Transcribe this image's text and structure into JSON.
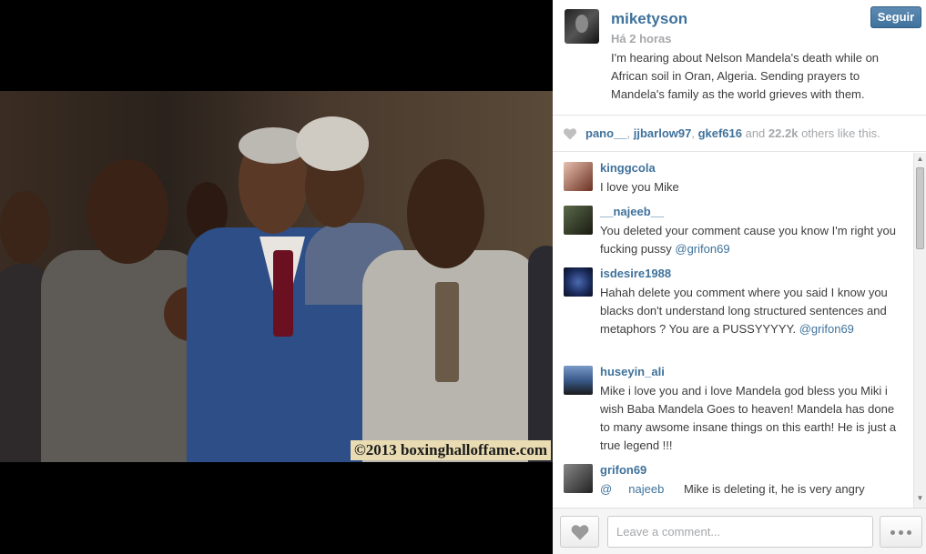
{
  "photo": {
    "watermark": "©2013 boxinghalloffame.com",
    "description_icon": "photo"
  },
  "post": {
    "username": "miketyson",
    "timestamp": "Há 2 horas",
    "caption": "I'm hearing about Nelson Mandela's death while on African soil in Oran, Algeria. Sending prayers to Mandela's family as the world grieves with them.",
    "follow_label": "Seguir"
  },
  "likes": {
    "users": [
      "pano__",
      "jjbarlow97",
      "gkef616"
    ],
    "sep": ", ",
    "and_label": " and ",
    "count": "22.2k",
    "suffix": " others like this."
  },
  "comments": [
    {
      "user": "kinggcola",
      "text": "I love you Mike",
      "mention": ""
    },
    {
      "user": "__najeeb__",
      "text": "You deleted your comment cause you know I'm right you fucking pussy ",
      "mention": "@grifon69"
    },
    {
      "user": "isdesire1988",
      "text": "Hahah delete you comment where you said I know you blacks don't understand long structured sentences and metaphors ? You are a PUSSYYYYY. ",
      "mention": "@grifon69"
    },
    {
      "user": "huseyin_ali",
      "text": "Mike i love you and i love Mandela god bless you Miki i wish Baba Mandela Goes to heaven! Mandela has done to many awsome insane things on this earth! He is just a true legend !!!",
      "mention": ""
    },
    {
      "user": "grifon69",
      "text": "Mike is deleting it, he is very angry",
      "mention": "@     najeeb"
    }
  ],
  "footer": {
    "comment_placeholder": "Leave a comment...",
    "like_icon": "heart-icon",
    "more_icon": "ellipsis-icon"
  },
  "colors": {
    "link": "#3f729b",
    "muted": "#a5a7aa",
    "text": "#3c3c3c",
    "follow_button": "#3f729b"
  }
}
